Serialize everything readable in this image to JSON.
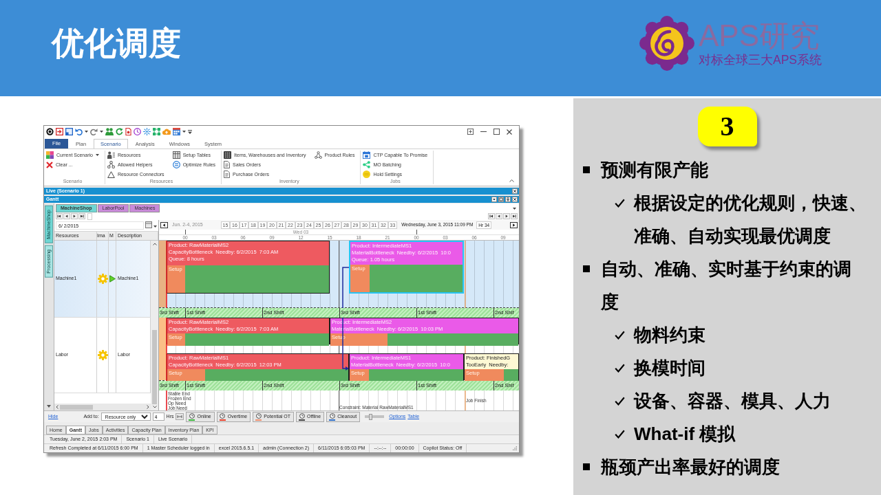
{
  "header": {
    "title": "优化调度",
    "logo_name": "APS研究",
    "logo_tagline": "对标全球三大APS系统"
  },
  "app": {
    "ribbon_tabs": [
      {
        "label": "File",
        "kind": "file",
        "selected": false
      },
      {
        "label": "Plan",
        "kind": "tab",
        "selected": false
      },
      {
        "label": "Scenario",
        "kind": "tab",
        "selected": true
      },
      {
        "label": "Analysis",
        "kind": "tab",
        "selected": false
      },
      {
        "label": "Windows",
        "kind": "tab",
        "selected": false
      },
      {
        "label": "System",
        "kind": "tab",
        "selected": false
      }
    ],
    "ribbon_groups": [
      {
        "label": "Scenario",
        "columns": [
          [
            {
              "label": "Current Scenario",
              "menu": true
            },
            {
              "label": "Clear ..."
            }
          ]
        ]
      },
      {
        "label": "Resources",
        "columns": [
          [
            {
              "label": "Resources"
            },
            {
              "label": "Allowed Helpers"
            },
            {
              "label": "Resource Connectors"
            }
          ],
          [
            {
              "label": "Setup Tables"
            },
            {
              "label": "Optimize Rules"
            }
          ]
        ]
      },
      {
        "label": "Inventory",
        "columns": [
          [
            {
              "label": "Items, Warehouses and Inventory"
            },
            {
              "label": "Sales Orders"
            },
            {
              "label": "Purchase Orders"
            }
          ],
          [
            {
              "label": "Product Rules"
            }
          ]
        ]
      },
      {
        "label": "Jobs",
        "columns": [
          [
            {
              "label": "CTP Capable To Promise"
            },
            {
              "label": "MO Batching"
            },
            {
              "label": "Hold Settings"
            }
          ]
        ]
      }
    ],
    "panels": [
      {
        "title": "Live (Scenario 1)",
        "kind": "document"
      },
      {
        "title": "Gantt",
        "kind": "tool"
      }
    ],
    "side_tabs": [
      {
        "label": "MachineShop",
        "selected": true
      },
      {
        "label": "Processing",
        "selected": false
      }
    ],
    "sheet_tabs": [
      {
        "label": "MachineShop",
        "color": "#6fd6d3",
        "selected": true
      },
      {
        "label": "LaborPool",
        "color": "#c98ad9",
        "selected": false
      },
      {
        "label": "Machines",
        "color": "#c98ad9",
        "selected": false
      }
    ],
    "date_field": {
      "value": "6/ 2/2015"
    },
    "grid_columns": [
      "Resources",
      "Ima",
      "M",
      "Description"
    ],
    "resources": [
      {
        "name": "Machine1",
        "description": "Machine1",
        "m_marker": true,
        "selected": true
      },
      {
        "name": "Labor",
        "description": "Labor",
        "m_marker": false,
        "selected": false
      }
    ],
    "timeline": {
      "range": "Jun. 2-4, 2015",
      "hour_buttons": [
        "15",
        "16",
        "17",
        "18",
        "19",
        "20",
        "21",
        "22",
        "23",
        "24",
        "25",
        "26",
        "27",
        "28",
        "29",
        "30",
        "31",
        "32",
        "33"
      ],
      "current_time": "Wednesday, June 3, 2015 11:09 PM",
      "hour_field": "Hr 34",
      "day_label": "Wed 03",
      "hour_ticks": [
        "00",
        "03",
        "06",
        "09",
        "12",
        "15",
        "18",
        "21",
        "00",
        "03",
        "06",
        "09"
      ]
    },
    "gantt": {
      "rows": [
        {
          "lanes": [
            {
              "blocks": [
                {
                  "product": "Product: RawMaterialMS2",
                  "reason": "CapacityBottleneck  Needby: 6/2/2015  7:03 AM",
                  "queue": "Queue: 8 hours",
                  "setup": "Setup",
                  "color": "#ee5a60",
                  "selected": false
                },
                {
                  "product": "Product: IntermediateMS1",
                  "reason": "MaterialBottleneck  Needby: 6/2/2015  10:0",
                  "queue": "Queue: 1.05 hours",
                  "setup": "Setup",
                  "color": "#ea5ae8",
                  "selected": true
                }
              ]
            }
          ],
          "shifts": [
            "3rd Shift",
            "1st Shift",
            "2nd Shift",
            "3rd Shift",
            "1st Shift",
            "2nd Shif"
          ]
        },
        {
          "lanes": [
            {
              "blocks": [
                {
                  "product": "Product: RawMaterialMS2",
                  "reason": "CapacityBottleneck  Needby: 6/2/2015  7:03 AM",
                  "setup": "Setup",
                  "color": "#ee5a60",
                  "selected": false
                },
                {
                  "product": "Product: IntermediateMS2",
                  "reason": "MaterialBottleneck  Needby: 6/2/2015  10:03 PM",
                  "setup": "Setup",
                  "color": "#ea5ae8",
                  "selected": false
                }
              ]
            },
            {
              "blocks": [
                {
                  "product": "Product: RawMaterialMS1",
                  "reason": "CapacityBottleneck  Needby: 6/2/2015  12:03 PM",
                  "setup": "Setup",
                  "color": "#ee5a60",
                  "selected": false
                },
                {
                  "product": "Product: IntermediateMS1",
                  "reason": "MaterialBottleneck  Needby: 6/2/2015  10:0",
                  "setup": "Setup",
                  "color": "#ea5ae8",
                  "selected": false
                },
                {
                  "product": "Product: FinishedG",
                  "reason": "TooEarly  Needby:",
                  "setup": "Setup",
                  "color": "#fdf8d4",
                  "selected": false
                }
              ]
            }
          ],
          "shifts": [
            "3rd Shift",
            "1st Shift",
            "2nd Shift",
            "3rd Shift",
            "1st Shift",
            "2nd Shif"
          ],
          "markers": [
            "Stable End",
            "Frozen End",
            "Op Need",
            "Job Need"
          ],
          "notes": [
            "Constraint: Material RawMaterialMS1",
            "Job Finish"
          ]
        }
      ]
    },
    "toolbar": {
      "hide_link": "Hide",
      "add_to_label": "Add to:",
      "add_to_value": "Resource only",
      "hours_value": "4",
      "hours_unit": "Hrs",
      "buttons": [
        {
          "label": "Online",
          "color": "#39b53a"
        },
        {
          "label": "Overtime",
          "color": "#e8412c"
        },
        {
          "label": "Potential OT",
          "color": "#f0906e"
        },
        {
          "label": "Offline",
          "color": "#444444"
        },
        {
          "label": "Cleanout",
          "color": "#2f6fc8"
        }
      ],
      "slider": {
        "level": 0.25
      },
      "links": [
        "Options",
        "Table"
      ]
    },
    "bottom_tabs": [
      {
        "label": "Home",
        "selected": false
      },
      {
        "label": "Gantt",
        "selected": true
      },
      {
        "label": "Jobs",
        "selected": false
      },
      {
        "label": "Activities",
        "selected": false
      },
      {
        "label": "Capacity Plan",
        "selected": false
      },
      {
        "label": "Inventory Plan",
        "selected": false
      },
      {
        "label": "KPI",
        "selected": false
      }
    ],
    "status_rows": [
      [
        "Tuesday, June 2, 2015 2:03 PM",
        "Scenario 1",
        "Live Scenario"
      ],
      [
        "Refresh Completed at 6/11/2015 6:00 PM",
        "1 Master Scheduler logged in",
        "excel 2015.6.5.1",
        "admin (Connection 2)",
        "6/11/2015 6:05:03 PM",
        "--:--:--",
        "00:00:00",
        "Copilot Status: Off"
      ]
    ]
  },
  "side_panel": {
    "step": "3",
    "points": [
      {
        "kind": "bullet",
        "text": "预测有限产能"
      },
      {
        "kind": "check",
        "text": "根据设定的优化规则，快速、准确、自动实现最优调度"
      },
      {
        "kind": "bullet",
        "text": "自动、准确、实时基于约束的调度"
      },
      {
        "kind": "check",
        "text": "物料约束"
      },
      {
        "kind": "check",
        "text": "换模时间"
      },
      {
        "kind": "check",
        "text": "设备、容器、模具、人力"
      },
      {
        "kind": "check",
        "text": "What-if 模拟"
      },
      {
        "kind": "bullet",
        "text": "瓶颈产出率最好的调度"
      }
    ]
  }
}
